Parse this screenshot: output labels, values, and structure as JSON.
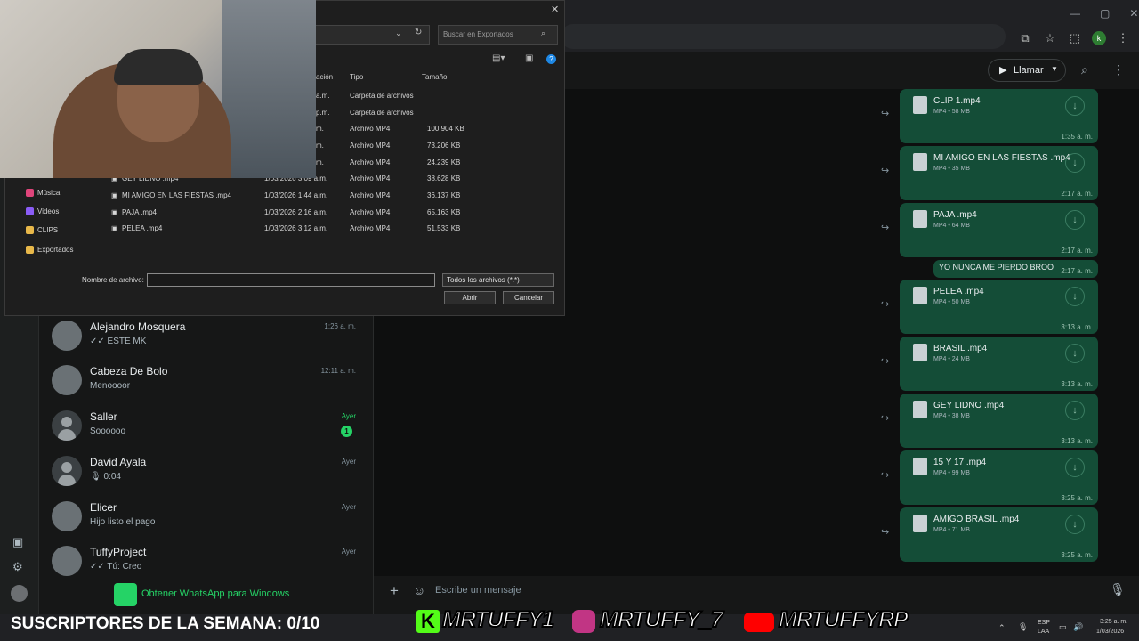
{
  "browser": {
    "window_controls": [
      "—",
      "▢",
      "✕"
    ],
    "profile_initial": "k"
  },
  "webcam": {
    "label": "webcam overlay"
  },
  "file_dialog": {
    "search_placeholder": "Buscar en Exportados",
    "columns": [
      "ación",
      "Tipo",
      "Tamaño"
    ],
    "rows": [
      {
        "name": "",
        "date": "a.m.",
        "type": "Carpeta de archivos",
        "size": ""
      },
      {
        "name": "",
        "date": "p.m.",
        "type": "Carpeta de archivos",
        "size": ""
      },
      {
        "name": "",
        "date": "m.",
        "type": "Archivo MP4",
        "size": "100.904 KB"
      },
      {
        "name": "",
        "date": "m.",
        "type": "Archivo MP4",
        "size": "73.206 KB"
      },
      {
        "name": "",
        "date": "m.",
        "type": "Archivo MP4",
        "size": "24.239 KB"
      },
      {
        "name": "GEY LIDNO .mp4",
        "date": "1/03/2026 3:09 a.m.",
        "type": "Archivo MP4",
        "size": "38.628 KB"
      },
      {
        "name": "MI AMIGO EN LAS FIESTAS .mp4",
        "date": "1/03/2026 1:44 a.m.",
        "type": "Archivo MP4",
        "size": "36.137 KB"
      },
      {
        "name": "PAJA .mp4",
        "date": "1/03/2026 2:16 a.m.",
        "type": "Archivo MP4",
        "size": "65.163 KB"
      },
      {
        "name": "PELEA .mp4",
        "date": "1/03/2026 3:12 a.m.",
        "type": "Archivo MP4",
        "size": "51.533 KB"
      }
    ],
    "nav": [
      {
        "label": "Música",
        "color": "#e0457b"
      },
      {
        "label": "Videos",
        "color": "#8a5cf6"
      },
      {
        "label": "CLIPS",
        "color": "#e8b84a"
      },
      {
        "label": "Exportados",
        "color": "#e8b84a"
      }
    ],
    "filename_label": "Nombre de archivo:",
    "filename_value": "",
    "filter": "Todos los archivos (*.*)",
    "open_label": "Abrir",
    "cancel_label": "Cancelar"
  },
  "chats": [
    {
      "name": "Alejandro Mosquera",
      "preview": "✓✓ ESTE MK",
      "time": "1:26 a. m.",
      "avatar": "photo",
      "unread": ""
    },
    {
      "name": "Cabeza De Bolo",
      "preview": "Menoooor",
      "time": "12:11 a. m.",
      "avatar": "photo",
      "unread": ""
    },
    {
      "name": "Saller",
      "preview": "Soooooo",
      "time": "Ayer",
      "avatar": "generic",
      "unread": "1"
    },
    {
      "name": "David Ayala",
      "preview": "🎙 0:04",
      "time": "Ayer",
      "avatar": "generic",
      "unread": ""
    },
    {
      "name": "Elicer",
      "preview": "Hijo listo el pago",
      "time": "Ayer",
      "avatar": "photo",
      "unread": ""
    },
    {
      "name": "TuffyProject",
      "preview": "✓✓ Tú: Creo",
      "time": "Ayer",
      "avatar": "photo",
      "unread": ""
    }
  ],
  "get_app": "Obtener WhatsApp para Windows",
  "header": {
    "call_label": "Llamar"
  },
  "messages": [
    {
      "name": "CLIP 1.mp4",
      "meta": "MP4 • 58 MB",
      "time": "1:35 a. m."
    },
    {
      "name": "MI AMIGO EN LAS FIESTAS .mp4",
      "meta": "MP4 • 35 MB",
      "time": "2:17 a. m."
    },
    {
      "name": "PAJA .mp4",
      "meta": "MP4 • 64 MB",
      "time": "2:17 a. m."
    },
    {
      "name": "PELEA .mp4",
      "meta": "MP4 • 50 MB",
      "time": "3:13 a. m."
    },
    {
      "name": "BRASIL .mp4",
      "meta": "MP4 • 24 MB",
      "time": "3:13 a. m."
    },
    {
      "name": "GEY LIDNO .mp4",
      "meta": "MP4 • 38 MB",
      "time": "3:13 a. m."
    },
    {
      "name": "15 Y 17 .mp4",
      "meta": "MP4 • 99 MB",
      "time": "3:25 a. m."
    },
    {
      "name": "AMIGO BRASIL .mp4",
      "meta": "MP4 • 71 MB",
      "time": "3:25 a. m."
    }
  ],
  "text_message": {
    "text": "YO NUNCA ME PIERDO BROO",
    "time": "2:17 a. m."
  },
  "composer": {
    "placeholder": "Escribe un mensaje"
  },
  "overlay": {
    "subscribers": "SUSCRIPTORES DE LA SEMANA: 0/10",
    "kick": "MRTUFFY1",
    "instagram": "MRTUFFY_7",
    "youtube": "MRTUFFYRP"
  },
  "taskbar": {
    "lang": "ESP",
    "lang2": "LAA",
    "time": "3:25 a. m.",
    "date": "1/03/2026"
  }
}
